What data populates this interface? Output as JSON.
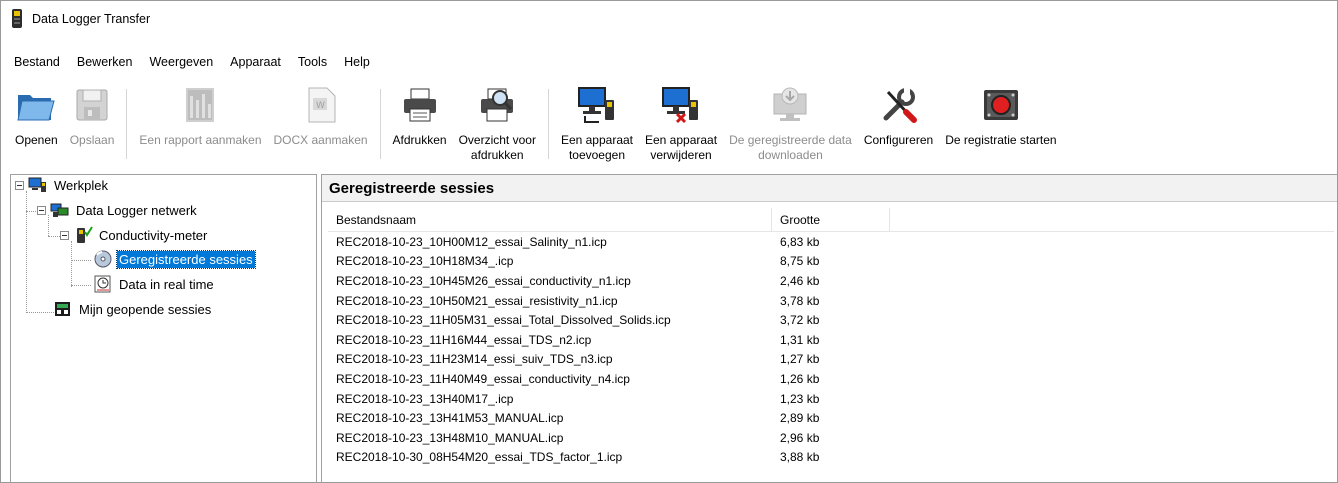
{
  "window": {
    "title": "Data Logger Transfer"
  },
  "menu": [
    "Bestand",
    "Bewerken",
    "Weergeven",
    "Apparaat",
    "Tools",
    "Help"
  ],
  "toolbar": {
    "open": "Openen",
    "save": "Opslaan",
    "report": "Een rapport aanmaken",
    "docx": "DOCX aanmaken",
    "print": "Afdrukken",
    "preview": "Overzicht voor\nafdrukken",
    "add_device": "Een apparaat\ntoevoegen",
    "remove_device": "Een apparaat\nverwijderen",
    "download": "De geregistreerde data\ndownloaden",
    "configure": "Configureren",
    "start_recording": "De registratie starten"
  },
  "tree": {
    "workplace": "Werkplek",
    "network": "Data Logger netwerk",
    "device": "Conductivity-meter",
    "recorded_sessions": "Geregistreerde sessies",
    "realtime": "Data in real time",
    "my_sessions": "Mijn geopende sessies"
  },
  "panel": {
    "title": "Geregistreerde sessies",
    "columns": [
      "Bestandsnaam",
      "Grootte"
    ],
    "rows": [
      {
        "name": "REC2018-10-23_10H00M12_essai_Salinity_n1.icp",
        "size": "6,83 kb"
      },
      {
        "name": "REC2018-10-23_10H18M34_.icp",
        "size": "8,75 kb"
      },
      {
        "name": "REC2018-10-23_10H45M26_essai_conductivity_n1.icp",
        "size": "2,46 kb"
      },
      {
        "name": "REC2018-10-23_10H50M21_essai_resistivity_n1.icp",
        "size": "3,78 kb"
      },
      {
        "name": "REC2018-10-23_11H05M31_essai_Total_Dissolved_Solids.icp",
        "size": "3,72 kb"
      },
      {
        "name": "REC2018-10-23_11H16M44_essai_TDS_n2.icp",
        "size": "1,31 kb"
      },
      {
        "name": "REC2018-10-23_11H23M14_essi_suiv_TDS_n3.icp",
        "size": "1,27 kb"
      },
      {
        "name": "REC2018-10-23_11H40M49_essai_conductivity_n4.icp",
        "size": "1,26 kb"
      },
      {
        "name": "REC2018-10-23_13H40M17_.icp",
        "size": "1,23 kb"
      },
      {
        "name": "REC2018-10-23_13H41M53_MANUAL.icp",
        "size": "2,89 kb"
      },
      {
        "name": "REC2018-10-23_13H48M10_MANUAL.icp",
        "size": "2,96 kb"
      },
      {
        "name": "REC2018-10-30_08H54M20_essai_TDS_factor_1.icp",
        "size": "3,88 kb"
      }
    ]
  }
}
